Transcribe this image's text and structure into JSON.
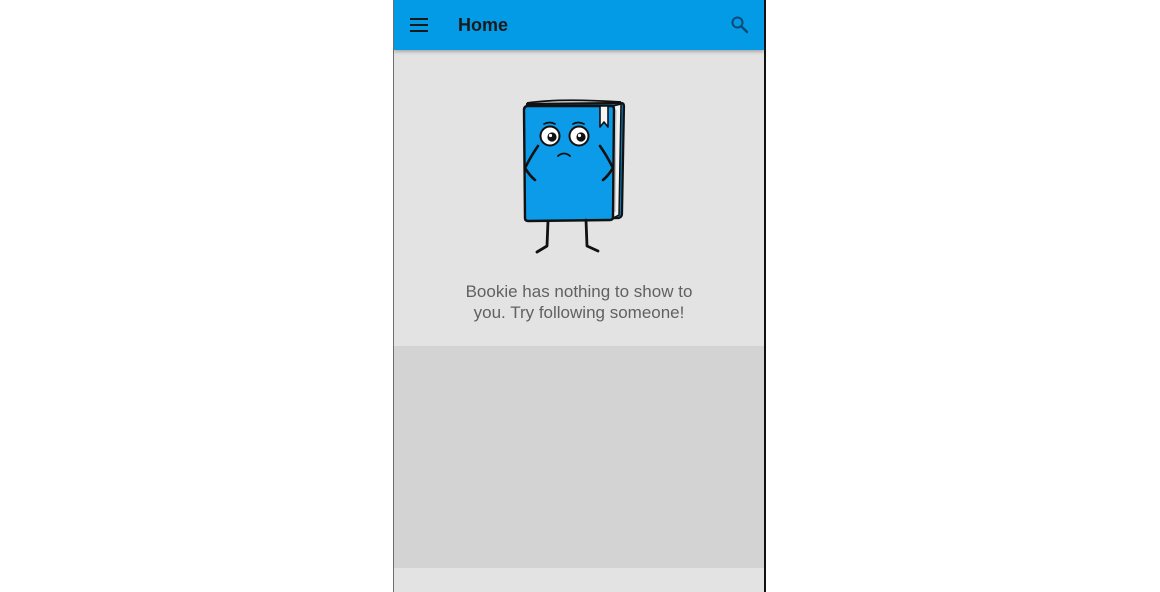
{
  "app_bar": {
    "title": "Home",
    "menu_icon": "hamburger-menu-icon",
    "search_icon": "search-icon"
  },
  "empty_state": {
    "illustration": "sad-book-mascot",
    "message": "Bookie has nothing to show to you. Try following someone!"
  },
  "colors": {
    "primary": "#039BE5",
    "background": "#E3E3E3",
    "placeholder": "#D3D3D3",
    "book_blue": "#0B9BE8",
    "message_text": "#616161"
  }
}
